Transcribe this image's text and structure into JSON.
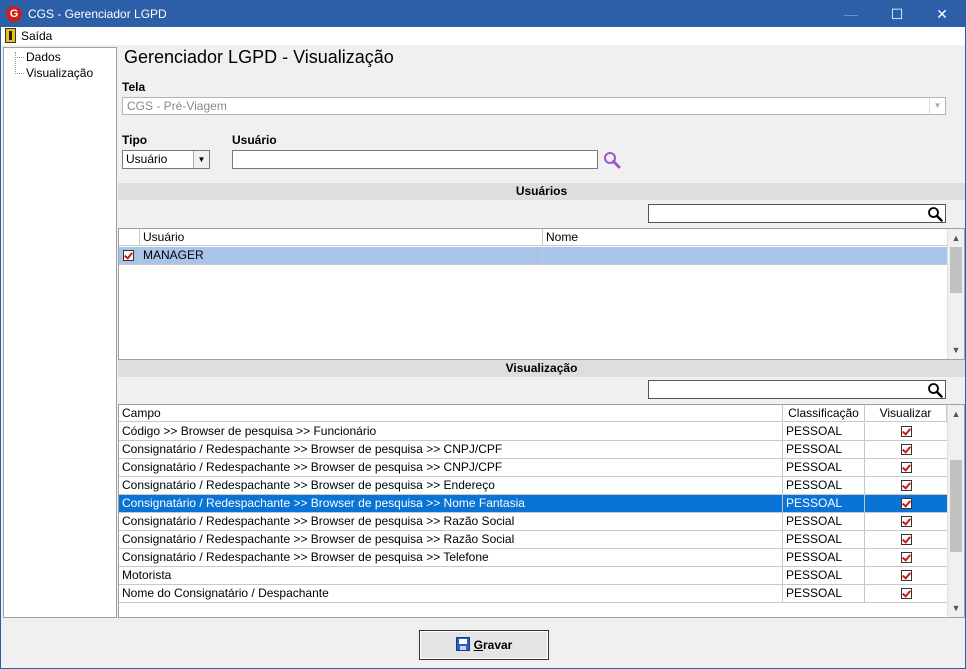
{
  "window": {
    "title": "CGS - Gerenciador LGPD",
    "minimize_glyph": "—",
    "maximize_glyph": "☐",
    "close_glyph": "✕",
    "app_icon_letter": "G"
  },
  "menu": {
    "exit_label": "Saída"
  },
  "tree": {
    "items": [
      "Dados",
      "Visualização"
    ]
  },
  "page": {
    "heading": "Gerenciador LGPD - Visualização"
  },
  "form": {
    "tela_label": "Tela",
    "tela_value": "CGS - Pré-Viagem",
    "tipo_label": "Tipo",
    "tipo_value": "Usuário",
    "usuario_label": "Usuário",
    "usuario_value": ""
  },
  "users_section": {
    "title": "Usuários",
    "search_value": "",
    "columns": [
      "Usuário",
      "Nome"
    ],
    "rows": [
      {
        "checked": true,
        "usuario": "MANAGER",
        "nome": ""
      }
    ]
  },
  "view_section": {
    "title": "Visualização",
    "search_value": "",
    "columns": [
      "Campo",
      "Classificação",
      "Visualizar"
    ],
    "rows": [
      {
        "campo": "Código >> Browser de pesquisa >> Funcionário",
        "classificacao": "PESSOAL",
        "visualizar": true
      },
      {
        "campo": "Consignatário / Redespachante >> Browser de pesquisa >> CNPJ/CPF",
        "classificacao": "PESSOAL",
        "visualizar": true
      },
      {
        "campo": "Consignatário / Redespachante >> Browser de pesquisa >> CNPJ/CPF",
        "classificacao": "PESSOAL",
        "visualizar": true
      },
      {
        "campo": "Consignatário / Redespachante >> Browser de pesquisa >> Endereço",
        "classificacao": "PESSOAL",
        "visualizar": true
      },
      {
        "campo": "Consignatário / Redespachante >> Browser de pesquisa >> Nome Fantasia",
        "classificacao": "PESSOAL",
        "visualizar": true,
        "selected": true
      },
      {
        "campo": "Consignatário / Redespachante >> Browser de pesquisa >> Razão Social",
        "classificacao": "PESSOAL",
        "visualizar": true
      },
      {
        "campo": "Consignatário / Redespachante >> Browser de pesquisa >> Razão Social",
        "classificacao": "PESSOAL",
        "visualizar": true
      },
      {
        "campo": "Consignatário / Redespachante >> Browser de pesquisa >> Telefone",
        "classificacao": "PESSOAL",
        "visualizar": true
      },
      {
        "campo": "Motorista",
        "classificacao": "PESSOAL",
        "visualizar": true
      },
      {
        "campo": "Nome do Consignatário / Despachante",
        "classificacao": "PESSOAL",
        "visualizar": true
      }
    ]
  },
  "actions": {
    "save_label_first": "G",
    "save_label_rest": "ravar"
  },
  "colors": {
    "titlebar": "#2d5ea8",
    "selection": "#0a74d6",
    "selection_light": "#a9c4ea",
    "check": "#d01818"
  },
  "icons": {
    "exit": "exit-door-icon",
    "search_purple": "magnifier-icon",
    "search": "magnifier-icon",
    "save": "floppy-disk-icon"
  }
}
